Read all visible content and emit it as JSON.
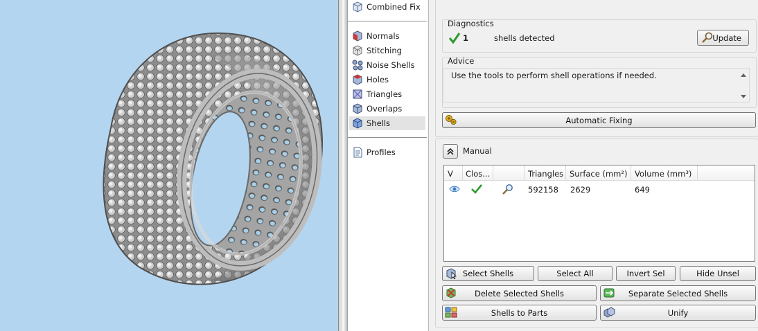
{
  "tree": {
    "top_item": {
      "label": "Combined Fix",
      "icon": "combined-fix-icon"
    },
    "items": [
      {
        "label": "Normals",
        "icon": "normals-icon"
      },
      {
        "label": "Stitching",
        "icon": "stitching-icon"
      },
      {
        "label": "Noise Shells",
        "icon": "noise-shells-icon"
      },
      {
        "label": "Holes",
        "icon": "holes-icon"
      },
      {
        "label": "Triangles",
        "icon": "triangles-icon"
      },
      {
        "label": "Overlaps",
        "icon": "overlaps-icon"
      },
      {
        "label": "Shells",
        "icon": "shells-icon",
        "selected": true
      }
    ],
    "profiles": {
      "label": "Profiles",
      "icon": "profiles-icon"
    }
  },
  "diagnostics": {
    "title": "Diagnostics",
    "count": "1",
    "text": "shells detected",
    "update_label": "Update"
  },
  "advice": {
    "title": "Advice",
    "text": "Use the tools to perform shell operations if needed."
  },
  "automatic_fixing_label": "Automatic Fixing",
  "manual": {
    "title": "Manual",
    "columns": [
      "V",
      "Clos...",
      "",
      "Triangles",
      "Surface (mm²)",
      "Volume (mm³)"
    ],
    "rows": [
      {
        "visible": "eye-icon",
        "closed": "check-icon",
        "zoom": "zoom-icon",
        "triangles": "592158",
        "surface": "2629",
        "volume": "649"
      }
    ]
  },
  "buttons": {
    "select_shells": "Select Shells",
    "select_all": "Select All",
    "invert_sel": "Invert Sel",
    "hide_unsel": "Hide Unsel",
    "delete_selected_shells": "Delete Selected Shells",
    "separate_selected_shells": "Separate Selected Shells",
    "shells_to_parts": "Shells to Parts",
    "unify": "Unify"
  },
  "colors": {
    "viewport_bg": "#b4d5f0",
    "check_green": "#2e9a2e",
    "selected_row": "#e3e3e3"
  }
}
